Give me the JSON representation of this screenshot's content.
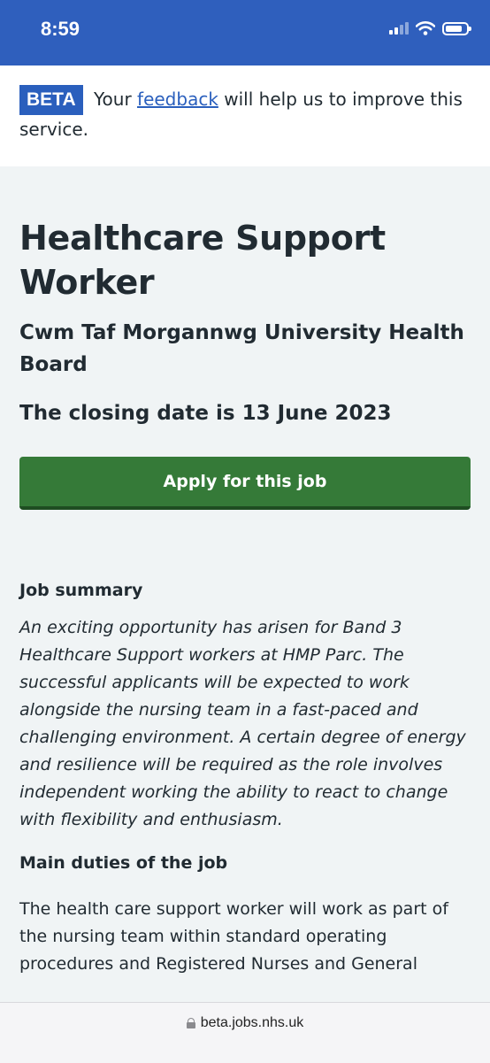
{
  "status_bar": {
    "time": "8:59"
  },
  "beta_banner": {
    "tag": "BETA",
    "text_before": "Your",
    "link": "feedback",
    "text_after": "will help us to improve this service."
  },
  "job": {
    "title": "Healthcare Support Worker",
    "employer": "Cwm Taf Morgannwg University Health Board",
    "closing_date": "The closing date is 13 June 2023",
    "apply_label": "Apply for this job"
  },
  "summary": {
    "heading": "Job summary",
    "text": "An exciting opportunity has arisen for Band 3 Healthcare Support workers at HMP Parc. The successful applicants will be expected to work alongside the nursing team in a fast-paced and challenging environment. A certain degree of energy and resilience will be required as the role involves independent working the ability to react to change with flexibility and enthusiasm."
  },
  "duties": {
    "heading": "Main duties of the job",
    "text": "The health care support worker will work as part of the nursing team within standard operating procedures and Registered Nurses and General"
  },
  "browser": {
    "url": "beta.jobs.nhs.uk"
  },
  "colors": {
    "header_blue": "#2f5fbd",
    "apply_green": "#357a38",
    "page_background": "#f0f4f5"
  }
}
